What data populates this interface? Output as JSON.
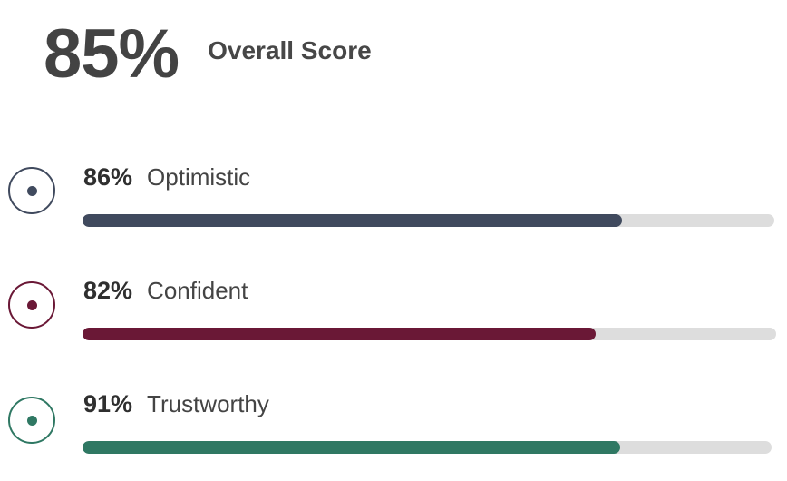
{
  "overall": {
    "value": "85%",
    "label": "Overall Score"
  },
  "metrics": [
    {
      "value": "86%",
      "label": "Optimistic",
      "bar_fraction": 0.78,
      "color": "#404a5e",
      "icon": "target-ring-icon"
    },
    {
      "value": "82%",
      "label": "Confident",
      "bar_fraction": 0.74,
      "color": "#6a1836",
      "icon": "target-ring-icon"
    },
    {
      "value": "91%",
      "label": "Trustworthy",
      "bar_fraction": 0.78,
      "color": "#2f7863",
      "icon": "target-ring-icon"
    }
  ]
}
